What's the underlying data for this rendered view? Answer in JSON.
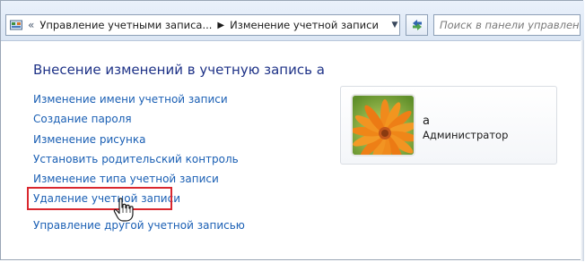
{
  "addressbar": {
    "breadcrumb_root": "Управление учетными записа...",
    "breadcrumb_current": "Изменение учетной записи",
    "search_placeholder": "Поиск в панели управления"
  },
  "main": {
    "title": "Внесение изменений в учетную запись a",
    "tasks": [
      "Изменение имени учетной записи",
      "Создание пароля",
      "Изменение рисунка",
      "Установить родительский контроль",
      "Изменение типа учетной записи",
      "Удаление учетной записи",
      "Управление другой учетной записью"
    ],
    "highlighted_task": "Удаление учетной записи"
  },
  "account": {
    "name": "a",
    "role": "Администратор"
  },
  "icons": {
    "control_panel": "control-panel-icon",
    "back_chevrons": "double-chevron-left-icon",
    "separator": "triangle-right-icon",
    "dropdown": "chevron-down-icon",
    "refresh": "refresh-icon",
    "cursor": "hand-pointer-icon",
    "avatar": "flower-avatar-icon"
  },
  "colors": {
    "link": "#1a5fb4",
    "title": "#1e3287",
    "highlight_border": "#d9272e"
  }
}
